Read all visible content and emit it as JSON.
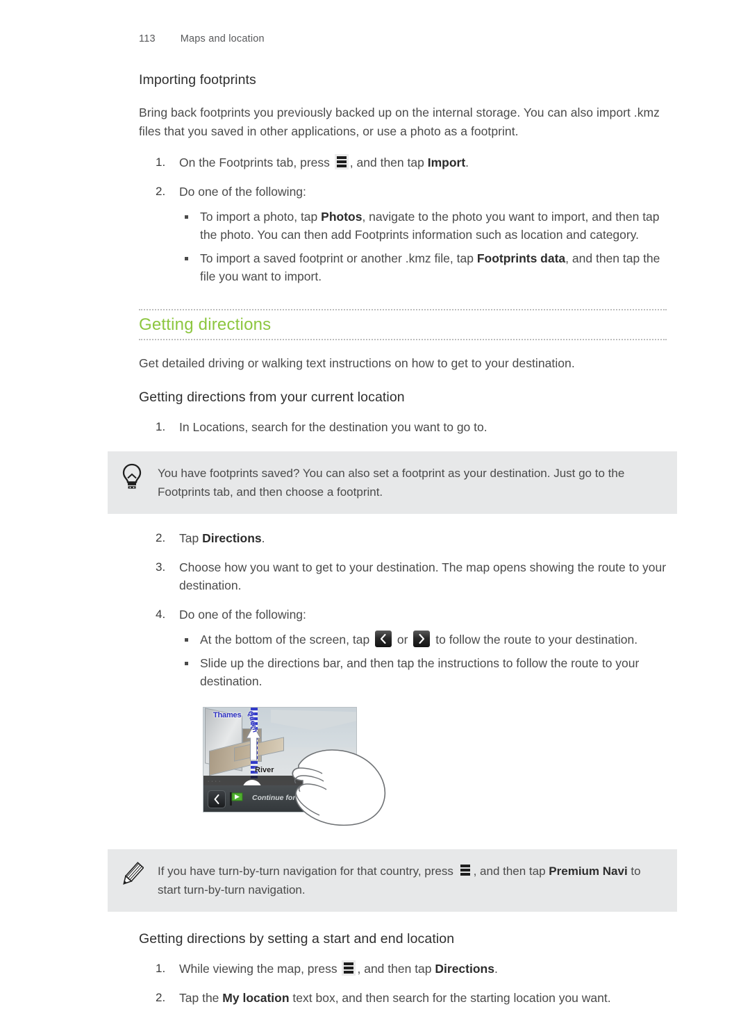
{
  "header": {
    "page_number": "113",
    "section": "Maps and location"
  },
  "importing": {
    "heading": "Importing footprints",
    "intro": "Bring back footprints you previously backed up on the internal storage. You can also import .kmz files that you saved in other applications, or use a photo as a footprint.",
    "step1_pre": "On the Footprints tab, press",
    "step1_mid": ", and then tap",
    "step1_bold": "Import",
    "step1_end": ".",
    "step2": "Do one of the following:",
    "bullet1_a": "To import a photo, tap ",
    "bullet1_bold": "Photos",
    "bullet1_b": ", navigate to the photo you want to import, and then tap the photo. You can then add Footprints information such as location and category.",
    "bullet2_a": "To import a saved footprint or another .kmz file, tap ",
    "bullet2_bold": "Footprints data",
    "bullet2_b": ", and then tap the file you want to import."
  },
  "directions": {
    "section_title": "Getting directions",
    "intro": "Get detailed driving or walking text instructions on how to get to your destination.",
    "sub_heading": "Getting directions from your current location",
    "step1": "In Locations, search for the destination you want to go to.",
    "tip": "You have footprints saved? You can also set a footprint as your destination. Just go to the Footprints tab, and then choose a footprint.",
    "tip_icon": "lightbulb-icon",
    "step2_pre": "Tap ",
    "step2_bold": "Directions",
    "step2_end": ".",
    "step3": "Choose how you want to get to your destination. The map opens showing the route to your destination.",
    "step4": "Do one of the following:",
    "bullet1_a": "At the bottom of the screen, tap",
    "bullet1_mid": "or",
    "bullet1_b": "to follow the route to your destination.",
    "bullet2": "Slide up the directions bar, and then tap the instructions to follow the route to your destination.",
    "note_a": "If you have turn-by-turn navigation for that country, press",
    "note_b": ", and then tap ",
    "note_bold": "Premium Navi",
    "note_c": " to start turn-by-turn navigation.",
    "note_icon": "pencil-icon"
  },
  "figure": {
    "map_label_thames": "Thames",
    "map_label_queen": "Queen",
    "map_label_river": "River",
    "direction_text": "Continue for 95 m o",
    "back_icon": "chevron-left-icon",
    "flag_icon": "green-flag-icon",
    "hand_icon": "hand-gesture-illustration"
  },
  "start_end": {
    "sub_heading": "Getting directions by setting a start and end location",
    "step1_pre": "While viewing the map, press",
    "step1_mid": ", and then tap ",
    "step1_bold": "Directions",
    "step1_end": ".",
    "step2_a": "Tap the ",
    "step2_bold": "My location",
    "step2_b": " text box, and then search for the starting location you want."
  },
  "colors": {
    "section_green": "#8cc63f",
    "callout_bg": "#e7e8e9",
    "body_text": "#4a4a4a"
  }
}
